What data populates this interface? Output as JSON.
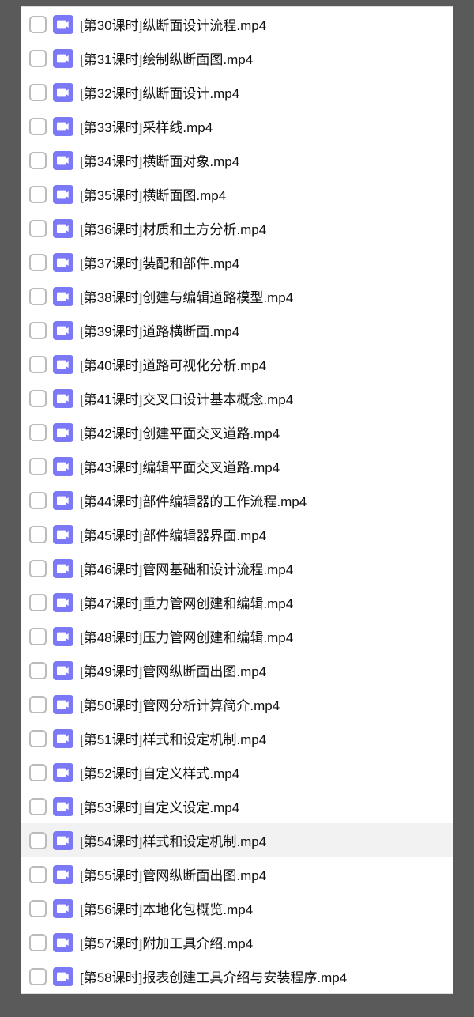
{
  "files": [
    {
      "name": "[第30课时]纵断面设计流程.mp4",
      "hovered": false
    },
    {
      "name": "[第31课时]绘制纵断面图.mp4",
      "hovered": false
    },
    {
      "name": "[第32课时]纵断面设计.mp4",
      "hovered": false
    },
    {
      "name": "[第33课时]采样线.mp4",
      "hovered": false
    },
    {
      "name": "[第34课时]横断面对象.mp4",
      "hovered": false
    },
    {
      "name": "[第35课时]横断面图.mp4",
      "hovered": false
    },
    {
      "name": "[第36课时]材质和土方分析.mp4",
      "hovered": false
    },
    {
      "name": "[第37课时]装配和部件.mp4",
      "hovered": false
    },
    {
      "name": "[第38课时]创建与编辑道路模型.mp4",
      "hovered": false
    },
    {
      "name": "[第39课时]道路横断面.mp4",
      "hovered": false
    },
    {
      "name": "[第40课时]道路可视化分析.mp4",
      "hovered": false
    },
    {
      "name": "[第41课时]交叉口设计基本概念.mp4",
      "hovered": false
    },
    {
      "name": "[第42课时]创建平面交叉道路.mp4",
      "hovered": false
    },
    {
      "name": "[第43课时]编辑平面交叉道路.mp4",
      "hovered": false
    },
    {
      "name": "[第44课时]部件编辑器的工作流程.mp4",
      "hovered": false
    },
    {
      "name": "[第45课时]部件编辑器界面.mp4",
      "hovered": false
    },
    {
      "name": "[第46课时]管网基础和设计流程.mp4",
      "hovered": false
    },
    {
      "name": "[第47课时]重力管网创建和编辑.mp4",
      "hovered": false
    },
    {
      "name": "[第48课时]压力管网创建和编辑.mp4",
      "hovered": false
    },
    {
      "name": "[第49课时]管网纵断面出图.mp4",
      "hovered": false
    },
    {
      "name": "[第50课时]管网分析计算简介.mp4",
      "hovered": false
    },
    {
      "name": "[第51课时]样式和设定机制.mp4",
      "hovered": false
    },
    {
      "name": "[第52课时]自定义样式.mp4",
      "hovered": false
    },
    {
      "name": "[第53课时]自定义设定.mp4",
      "hovered": false
    },
    {
      "name": "[第54课时]样式和设定机制.mp4",
      "hovered": true
    },
    {
      "name": "[第55课时]管网纵断面出图.mp4",
      "hovered": false
    },
    {
      "name": "[第56课时]本地化包概览.mp4",
      "hovered": false
    },
    {
      "name": "[第57课时]附加工具介绍.mp4",
      "hovered": false
    },
    {
      "name": "[第58课时]报表创建工具介绍与安装程序.mp4",
      "hovered": false
    }
  ]
}
